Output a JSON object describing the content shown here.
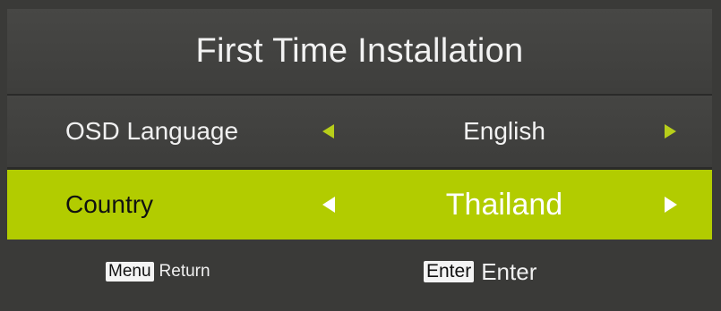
{
  "header": {
    "title": "First Time Installation"
  },
  "settings": [
    {
      "label": "OSD Language",
      "value": "English",
      "selected": false
    },
    {
      "label": "Country",
      "value": "Thailand",
      "selected": true
    }
  ],
  "footer": {
    "menu_key": "Menu",
    "menu_action": "Return",
    "enter_key": "Enter",
    "enter_action": "Enter"
  },
  "colors": {
    "background": "#3a3a38",
    "highlight": "#b2cc00",
    "arrow_inactive": "#b7ce1a",
    "text": "#f0f0f0"
  }
}
